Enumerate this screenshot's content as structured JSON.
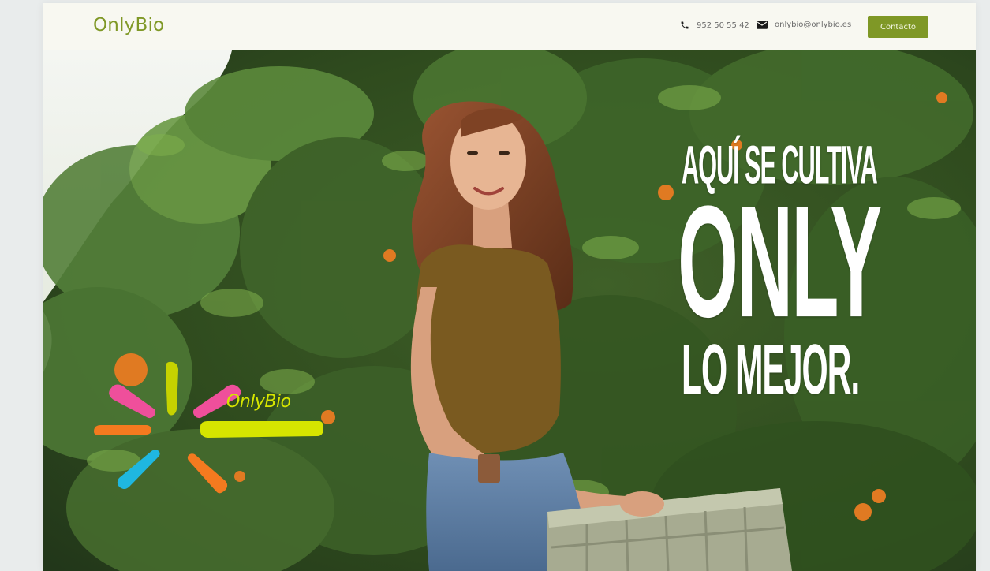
{
  "header": {
    "brand": "OnlyBio",
    "phone": "952 50 55 42",
    "email": "onlybio@onlybio.es",
    "contact_button": "Contacto"
  },
  "hero": {
    "headline": {
      "line1": "AQUÍ SE CULTIVA",
      "line2": "ONLY",
      "line3": "LO MEJOR."
    },
    "logo_text": "OnlyBio"
  },
  "colors": {
    "brand_green": "#7f9826",
    "logo_yellow": "#d6e500",
    "logo_pink": "#ef4f9b",
    "logo_orange": "#f47a1f",
    "logo_blue": "#1fb7e0"
  },
  "icons": {
    "phone": "phone-icon",
    "email": "email-icon"
  }
}
